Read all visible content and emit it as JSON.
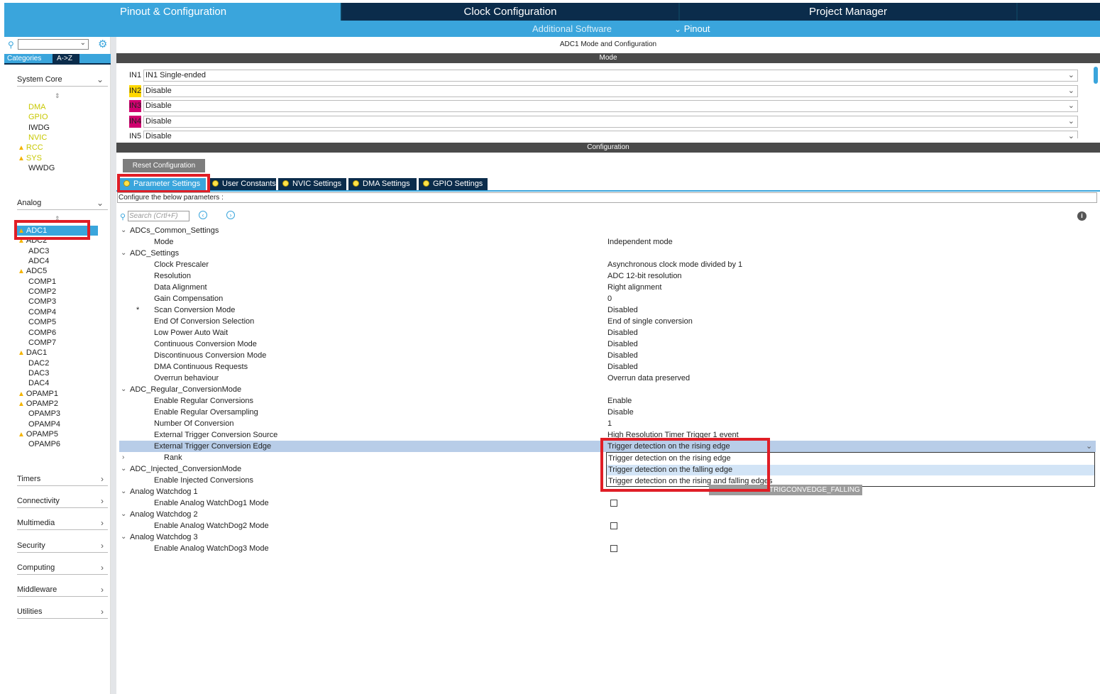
{
  "top_tabs": [
    "Pinout & Configuration",
    "Clock Configuration",
    "Project Manager"
  ],
  "sub_nav": {
    "additional_software": "Additional Software",
    "pinout": "Pinout"
  },
  "left": {
    "search_value": "",
    "cat_tabs": [
      "Categories",
      "A->Z"
    ],
    "system_core": {
      "label": "System Core",
      "items": [
        {
          "label": "DMA",
          "color": "#c8c800",
          "warn": false
        },
        {
          "label": "GPIO",
          "color": "#c8c800",
          "warn": false
        },
        {
          "label": "IWDG",
          "color": "#222222",
          "warn": false
        },
        {
          "label": "NVIC",
          "color": "#c8c800",
          "warn": false
        },
        {
          "label": "RCC",
          "color": "#c8c800",
          "warn": true
        },
        {
          "label": "SYS",
          "color": "#c8c800",
          "warn": true
        },
        {
          "label": "WWDG",
          "color": "#222222",
          "warn": false
        }
      ]
    },
    "analog": {
      "label": "Analog",
      "items": [
        {
          "label": "ADC1",
          "warn": true,
          "selected": true
        },
        {
          "label": "ADC2",
          "warn": true
        },
        {
          "label": "ADC3",
          "warn": false
        },
        {
          "label": "ADC4",
          "warn": false
        },
        {
          "label": "ADC5",
          "warn": true
        },
        {
          "label": "COMP1",
          "warn": false
        },
        {
          "label": "COMP2",
          "warn": false
        },
        {
          "label": "COMP3",
          "warn": false
        },
        {
          "label": "COMP4",
          "warn": false
        },
        {
          "label": "COMP5",
          "warn": false
        },
        {
          "label": "COMP6",
          "warn": false
        },
        {
          "label": "COMP7",
          "warn": false
        },
        {
          "label": "DAC1",
          "warn": true
        },
        {
          "label": "DAC2",
          "warn": false
        },
        {
          "label": "DAC3",
          "warn": false
        },
        {
          "label": "DAC4",
          "warn": false
        },
        {
          "label": "OPAMP1",
          "warn": true
        },
        {
          "label": "OPAMP2",
          "warn": true
        },
        {
          "label": "OPAMP3",
          "warn": false
        },
        {
          "label": "OPAMP4",
          "warn": false
        },
        {
          "label": "OPAMP5",
          "warn": true
        },
        {
          "label": "OPAMP6",
          "warn": false
        }
      ]
    },
    "categories": [
      "Timers",
      "Connectivity",
      "Multimedia",
      "Security",
      "Computing",
      "Middleware",
      "Utilities"
    ]
  },
  "main": {
    "title": "ADC1 Mode and Configuration",
    "mode_bar": "Mode",
    "mode_rows": [
      {
        "label": "IN1",
        "value": "IN1 Single-ended",
        "bg": "transparent"
      },
      {
        "label": "IN2",
        "value": "Disable",
        "bg": "#ffd800"
      },
      {
        "label": "IN3",
        "value": "Disable",
        "bg": "#d0006f"
      },
      {
        "label": "IN4",
        "value": "Disable",
        "bg": "#d0006f"
      },
      {
        "label": "IN5",
        "value": "Disable",
        "bg": "transparent"
      }
    ],
    "config_bar": "Configuration",
    "reset_button": "Reset Configuration",
    "tabs": [
      "Parameter Settings",
      "User Constants",
      "NVIC Settings",
      "DMA Settings",
      "GPIO Settings"
    ],
    "configure_text": "Configure the below parameters :",
    "search_placeholder": "Search (Crtl+F)",
    "params": [
      {
        "label": "ADCs_Common_Settings",
        "value": "",
        "level": 0,
        "expander": "v"
      },
      {
        "label": "Mode",
        "value": "Independent mode",
        "level": 1
      },
      {
        "label": "ADC_Settings",
        "value": "",
        "level": 0,
        "expander": "v"
      },
      {
        "label": "Clock Prescaler",
        "value": "Asynchronous clock mode divided by 1",
        "level": 1
      },
      {
        "label": "Resolution",
        "value": "ADC 12-bit resolution",
        "level": 1
      },
      {
        "label": "Data Alignment",
        "value": "Right alignment",
        "level": 1
      },
      {
        "label": "Gain Compensation",
        "value": "0",
        "level": 1
      },
      {
        "label": "Scan Conversion Mode",
        "value": "Disabled",
        "level": 1,
        "star": true
      },
      {
        "label": "End Of Conversion Selection",
        "value": "End of single conversion",
        "level": 1
      },
      {
        "label": "Low Power Auto Wait",
        "value": "Disabled",
        "level": 1
      },
      {
        "label": "Continuous Conversion Mode",
        "value": "Disabled",
        "level": 1
      },
      {
        "label": "Discontinuous Conversion Mode",
        "value": "Disabled",
        "level": 1
      },
      {
        "label": "DMA Continuous Requests",
        "value": "Disabled",
        "level": 1
      },
      {
        "label": "Overrun behaviour",
        "value": "Overrun data preserved",
        "level": 1
      },
      {
        "label": "ADC_Regular_ConversionMode",
        "value": "",
        "level": 0,
        "expander": "v"
      },
      {
        "label": "Enable Regular Conversions",
        "value": "Enable",
        "level": 1
      },
      {
        "label": "Enable Regular Oversampling",
        "value": "Disable",
        "level": 1
      },
      {
        "label": "Number Of Conversion",
        "value": "1",
        "level": 1
      },
      {
        "label": "External Trigger Conversion Source",
        "value": "High Resolution Timer Trigger 1 event",
        "level": 1
      },
      {
        "label": "External Trigger Conversion Edge",
        "value": "Trigger detection on the rising edge",
        "level": 1,
        "selected": true
      },
      {
        "label": "Rank",
        "value": "",
        "level": 2,
        "expander": ">"
      },
      {
        "label": "ADC_Injected_ConversionMode",
        "value": "",
        "level": 0,
        "expander": "v"
      },
      {
        "label": "Enable Injected Conversions",
        "value": "",
        "level": 1
      },
      {
        "label": "Analog Watchdog 1",
        "value": "",
        "level": 0,
        "expander": "v"
      },
      {
        "label": "Enable Analog WatchDog1 Mode",
        "value": "",
        "level": 1,
        "checkbox": true
      },
      {
        "label": "Analog Watchdog 2",
        "value": "",
        "level": 0,
        "expander": "v"
      },
      {
        "label": "Enable Analog WatchDog2 Mode",
        "value": "",
        "level": 1,
        "checkbox": true
      },
      {
        "label": "Analog Watchdog 3",
        "value": "",
        "level": 0,
        "expander": "v"
      },
      {
        "label": "Enable Analog WatchDog3 Mode",
        "value": "",
        "level": 1,
        "checkbox": true
      }
    ],
    "dropdown_options": [
      "Trigger detection on the rising edge",
      "Trigger detection on the falling edge",
      "Trigger detection on the rising and falling edges"
    ],
    "tooltip": "TRIGCONVEDGE_FALLING"
  },
  "colors": {
    "accent": "#3aa5dc",
    "dark_tab": "#0b2c4b",
    "highlight": "#e01e26",
    "row_select": "#b8cde8"
  }
}
